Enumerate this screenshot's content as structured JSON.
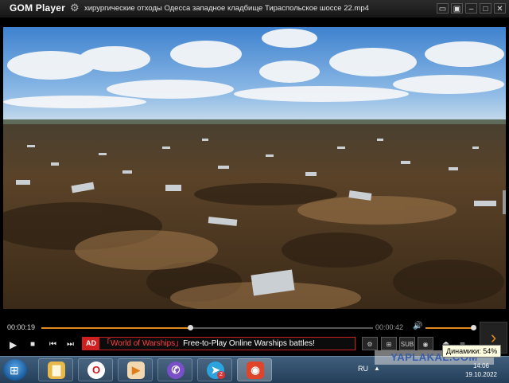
{
  "app": {
    "logo": "GOM Player",
    "title": "хирургические отходы Одесса западное кладбище Тираспольское шоссе 22.mp4",
    "window_buttons": [
      "▭",
      "▣",
      "‒",
      "□",
      "✕"
    ]
  },
  "playback": {
    "elapsed": "00:00:19",
    "total": "00:00:42",
    "seek_fraction": 0.45,
    "volume_fraction": 0.95
  },
  "ad": {
    "tag": "AD",
    "brand": "「World of Warships」",
    "text": "Free-to-Play Online Warships battles!"
  },
  "tools": [
    "⚙",
    "⊞",
    "SUB",
    "◉"
  ],
  "taskbar": {
    "apps": [
      {
        "name": "explorer",
        "glyph": "▇",
        "color": "#e8b84a"
      },
      {
        "name": "opera",
        "glyph": "O",
        "color": "#d3141c"
      },
      {
        "name": "media",
        "glyph": "▶",
        "color": "#e07b1a"
      },
      {
        "name": "viber",
        "glyph": "✆",
        "color": "#7a50c8"
      },
      {
        "name": "telegram",
        "glyph": "➤",
        "color": "#2aa3de",
        "badge": "2"
      },
      {
        "name": "gom",
        "glyph": "◉",
        "color": "#e0442a"
      }
    ],
    "language": "RU",
    "time": "14:06",
    "date": "19.10.2022"
  },
  "tooltip": "Динамики: 54%",
  "watermark": "YAPLAKAL.COM"
}
